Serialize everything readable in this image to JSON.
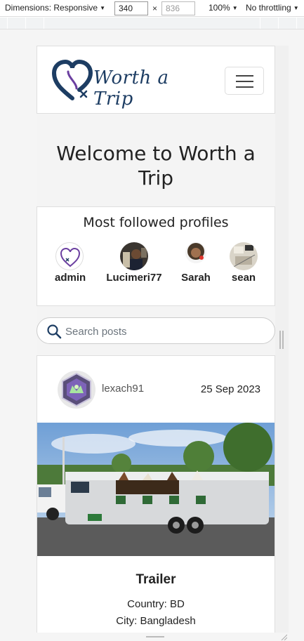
{
  "devtools": {
    "dimensions_label": "Dimensions: Responsive",
    "width": "340",
    "height": "836",
    "times": "×",
    "zoom": "100%",
    "throttling": "No throttling"
  },
  "site": {
    "brand": "Worth a Trip"
  },
  "hero": {
    "title": "Welcome to Worth a Trip"
  },
  "profiles": {
    "heading": "Most followed profiles",
    "items": [
      {
        "name": "admin"
      },
      {
        "name": "Lucimeri77"
      },
      {
        "name": "Sarah"
      },
      {
        "name": "sean"
      }
    ]
  },
  "search": {
    "placeholder": "Search posts"
  },
  "post": {
    "author": "lexach91",
    "date": "25 Sep 2023",
    "title": "Trailer",
    "country": "Country: BD",
    "city": "City: Bangladesh"
  },
  "colors": {
    "brand_navy": "#1d3d63",
    "brand_purple": "#6b3fa0"
  }
}
